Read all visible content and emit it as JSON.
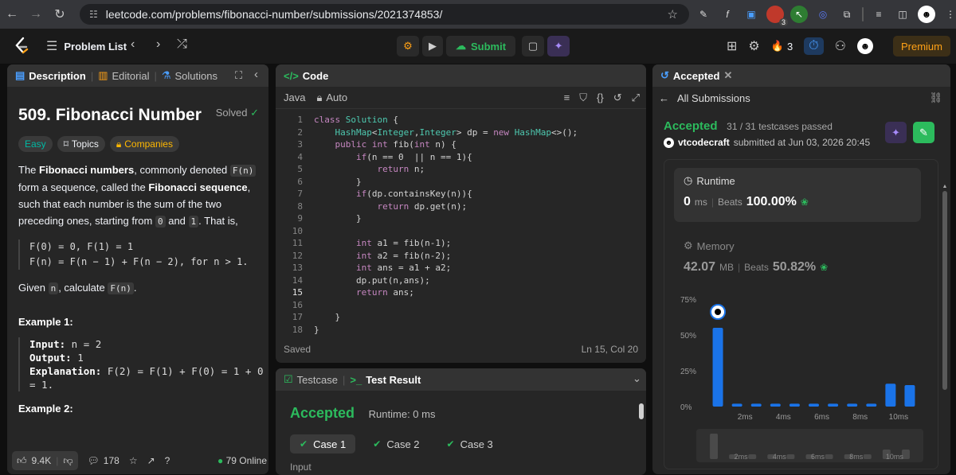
{
  "browser": {
    "url": "leetcode.com/problems/fibonacci-number/submissions/2021374853/",
    "extension_badge": "3"
  },
  "nav": {
    "problem_list": "Problem List",
    "submit": "Submit",
    "streak": "3",
    "premium": "Premium"
  },
  "left": {
    "tabs": [
      "Description",
      "Editorial",
      "Solutions"
    ],
    "title": "509. Fibonacci Number",
    "solved": "Solved",
    "tags": [
      "Easy",
      "Topics",
      "Companies"
    ],
    "p1": {
      "a": "The ",
      "b": "Fibonacci numbers",
      "c": ", commonly denoted ",
      "d": "F(n)",
      "e": " form a sequence, called the ",
      "f": "Fibonacci sequence",
      "g": ", such that each number is the sum of the two preceding ones, starting from ",
      "h": "0",
      "i": " and ",
      "j": "1",
      "k": ". That is,"
    },
    "formula": "F(0) = 0, F(1) = 1\nF(n) = F(n − 1) + F(n − 2), for n > 1.",
    "p2": {
      "a": "Given ",
      "b": "n",
      "c": ", calculate ",
      "d": "F(n)",
      "e": "."
    },
    "example1_head": "Example 1:",
    "example1": {
      "input_label": "Input:",
      "input": " n = 2",
      "output_label": "Output:",
      "output": " 1",
      "expl_label": "Explanation:",
      "expl": " F(2) = F(1) + F(0) = 1 + 0\n= 1."
    },
    "example2_head": "Example 2:",
    "likes": "9.4K",
    "comments": "178",
    "online": "79 Online"
  },
  "code": {
    "tab": "Code",
    "language": "Java",
    "mode": "Auto",
    "lines": [
      {
        "n": "1",
        "t": "class Solution {"
      },
      {
        "n": "2",
        "t": "    HashMap<Integer,Integer> dp = new HashMap<>();"
      },
      {
        "n": "3",
        "t": "    public int fib(int n) {"
      },
      {
        "n": "4",
        "t": "        if(n == 0  || n == 1){"
      },
      {
        "n": "5",
        "t": "            return n;"
      },
      {
        "n": "6",
        "t": "        }"
      },
      {
        "n": "7",
        "t": "        if(dp.containsKey(n)){"
      },
      {
        "n": "8",
        "t": "            return dp.get(n);"
      },
      {
        "n": "9",
        "t": "        }"
      },
      {
        "n": "10",
        "t": ""
      },
      {
        "n": "11",
        "t": "        int a1 = fib(n-1);"
      },
      {
        "n": "12",
        "t": "        int a2 = fib(n-2);"
      },
      {
        "n": "13",
        "t": "        int ans = a1 + a2;"
      },
      {
        "n": "14",
        "t": "        dp.put(n,ans);"
      },
      {
        "n": "15",
        "t": "        return ans;"
      },
      {
        "n": "16",
        "t": ""
      },
      {
        "n": "17",
        "t": "    }"
      },
      {
        "n": "18",
        "t": "}"
      }
    ],
    "status": "Saved",
    "cursor": "Ln 15, Col 20"
  },
  "result": {
    "tabs": [
      "Testcase",
      "Test Result"
    ],
    "status": "Accepted",
    "runtime": "Runtime: 0 ms",
    "cases": [
      "Case 1",
      "Case 2",
      "Case 3"
    ],
    "input_label": "Input"
  },
  "submission": {
    "tab": "Accepted",
    "back": "All Submissions",
    "status": "Accepted",
    "passed": "31 / 31 testcases passed",
    "user": "vtcodecraft",
    "submitted": "submitted at Jun 03, 2026 20:45",
    "runtime_label": "Runtime",
    "runtime_value": "0",
    "runtime_unit": "ms",
    "beats_label": "Beats",
    "runtime_beats": "100.00%",
    "memory_label": "Memory",
    "memory_value": "42.07",
    "memory_unit": "MB",
    "memory_beats": "50.82%"
  },
  "chart_data": {
    "type": "bar",
    "y_ticks": [
      "75%",
      "50%",
      "25%",
      "0%"
    ],
    "x_ticks": [
      "2ms",
      "4ms",
      "6ms",
      "8ms",
      "10ms"
    ],
    "ylim": [
      0,
      75
    ],
    "values": [
      55,
      2,
      2,
      2,
      2,
      2,
      2,
      2,
      2,
      16,
      15
    ],
    "highlight_index": 0,
    "mini_values": [
      16,
      3,
      3,
      3,
      3,
      3,
      3,
      3,
      3,
      6,
      6
    ],
    "colors": {
      "bar": "#1a73e8",
      "mini": "#4a4a4a"
    }
  }
}
